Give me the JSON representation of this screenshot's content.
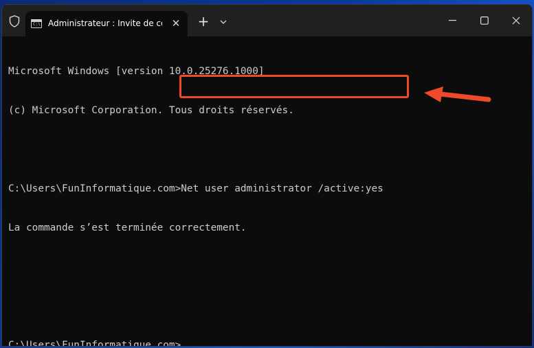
{
  "window": {
    "tab_title": "Administrateur : Invite de con",
    "tab_close_glyph": "✕",
    "new_tab_glyph": "+"
  },
  "console": {
    "lines": [
      "Microsoft Windows [version 10.0.25276.1000]",
      "(c) Microsoft Corporation. Tous droits réservés.",
      "",
      "C:\\Users\\FunInformatique.com>Net user administrator /active:yes",
      "La commande s’est terminée correctement.",
      "",
      "",
      "C:\\Users\\FunInformatique.com>"
    ]
  },
  "icons": {
    "shield": "shield-icon",
    "terminal": "terminal-icon",
    "chevron": "chevron-down-icon",
    "minimize": "minimize-icon",
    "maximize": "maximize-icon",
    "close": "close-icon",
    "arrow": "arrow-left-icon"
  },
  "colors": {
    "accent": "#ee4a2a",
    "console_bg": "#0c0c0c",
    "console_text": "#cccccc",
    "titlebar_bg": "#202020"
  }
}
